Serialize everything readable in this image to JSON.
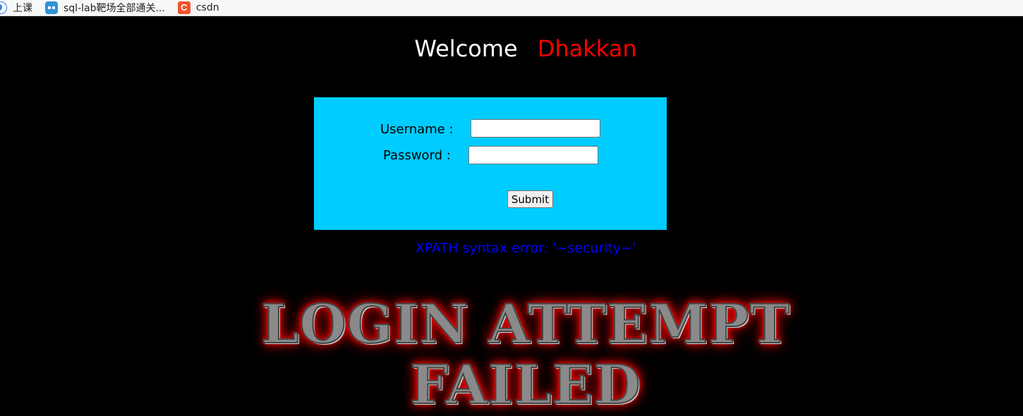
{
  "bookmarks": [
    {
      "label": "上课",
      "icon": "globe-icon"
    },
    {
      "label": "sql-lab靶场全部通关...",
      "icon": "robot-icon"
    },
    {
      "label": "csdn",
      "icon": "csdn-icon",
      "icon_glyph": "C"
    }
  ],
  "welcome": {
    "word1": "Welcome",
    "word2": "Dhakkan",
    "word1_color": "#ffffff",
    "word2_color": "#ff0000"
  },
  "form": {
    "background": "#00ccff",
    "username_label": "Username :",
    "password_label": "Password :",
    "username_value": "",
    "password_value": "",
    "submit_label": "Submit"
  },
  "error": {
    "message": "XPATH syntax error: '~security~'",
    "color": "#0000ff"
  },
  "banner": {
    "line1": "LOGIN ATTEMPT",
    "line2": "FAILED"
  }
}
